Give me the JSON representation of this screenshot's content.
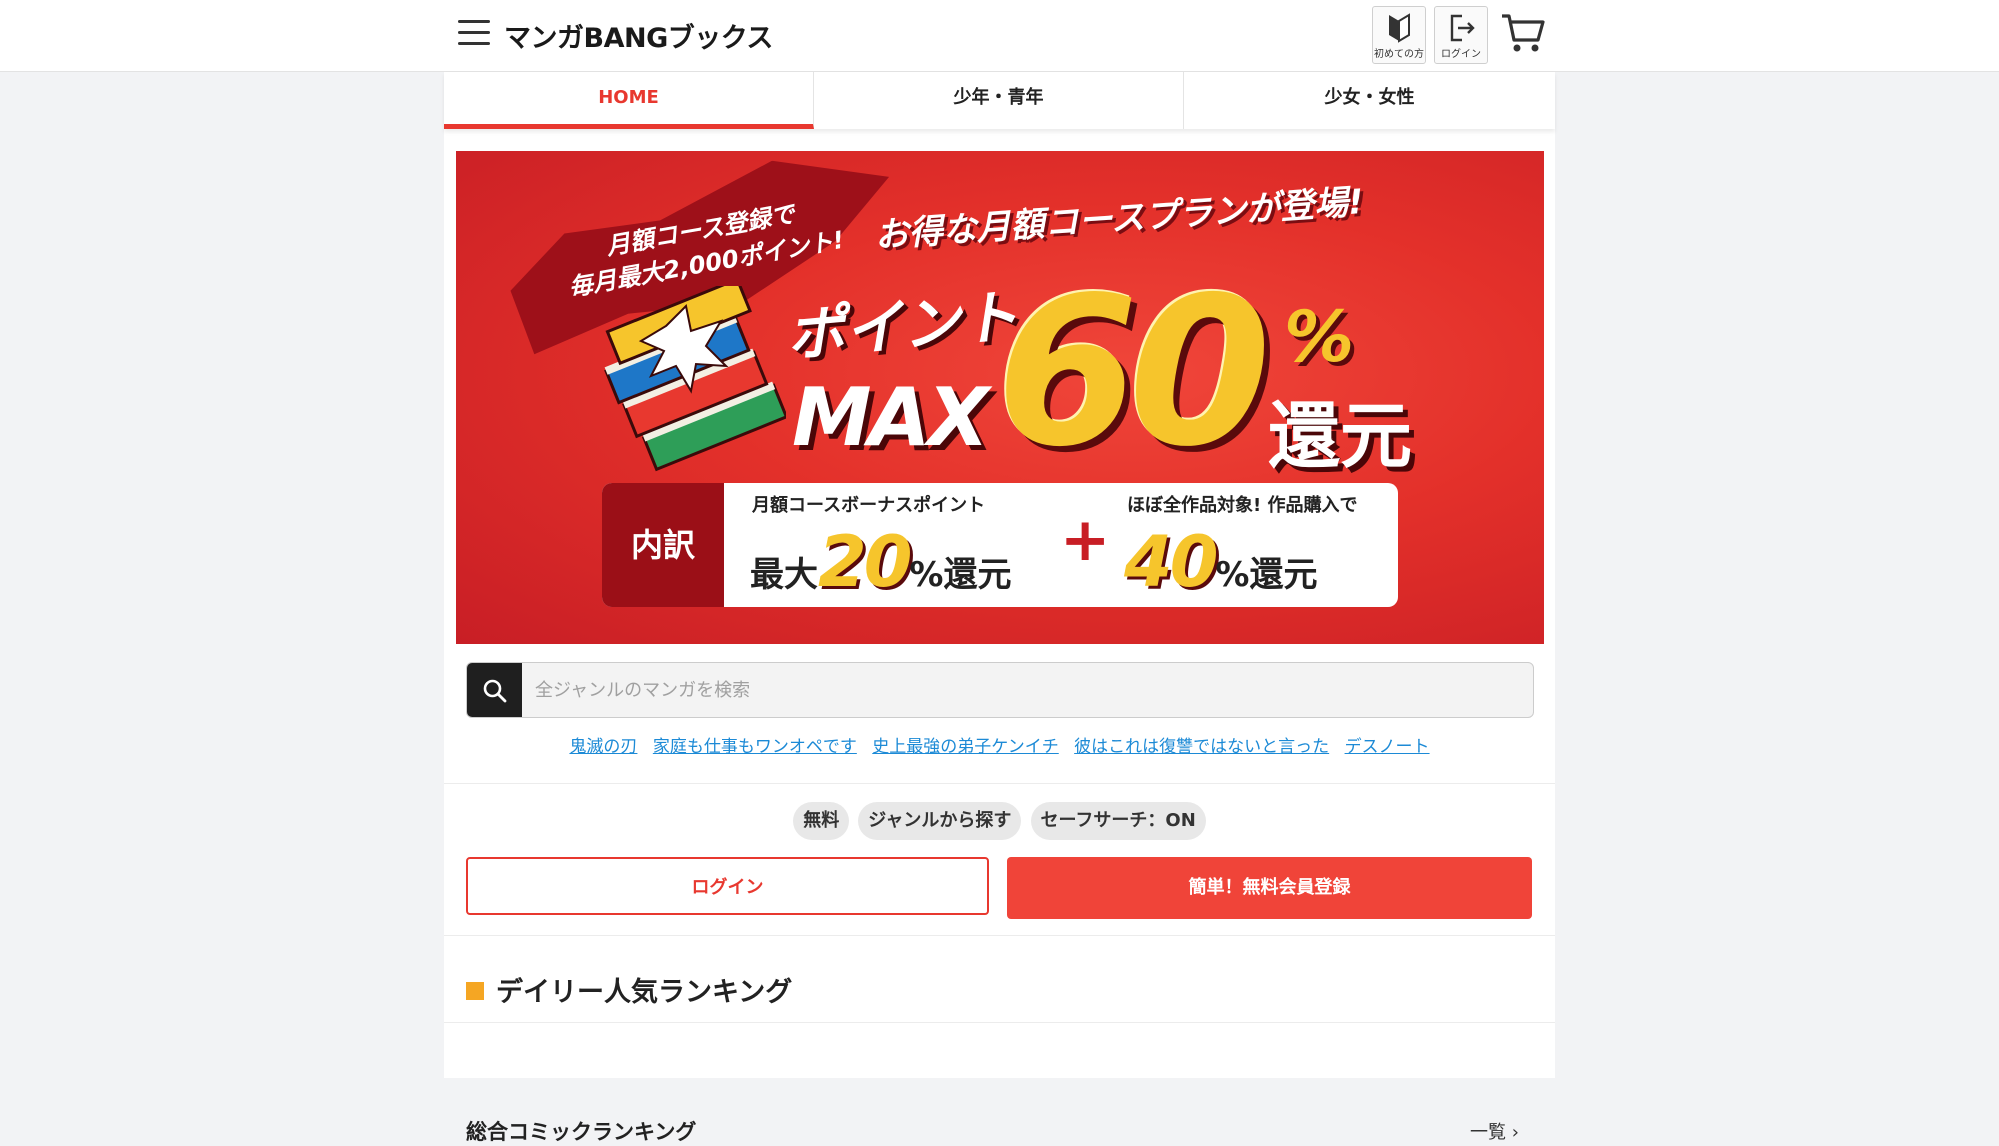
{
  "header": {
    "logo": "マンガBANGブックス",
    "beginner_label": "初めての方",
    "login_icon_label": "ログイン"
  },
  "tabs": [
    {
      "label": "HOME",
      "active": true
    },
    {
      "label": "少年・青年",
      "active": false
    },
    {
      "label": "少女・女性",
      "active": false
    }
  ],
  "banner": {
    "burst_line1": "月額コース登録で",
    "burst_line2": "毎月最大2,000ポイント!",
    "headline": "お得な月額コースプランが登場!",
    "point": "ポイント",
    "max": "MAX",
    "big_number": "60",
    "percent": "%",
    "kangen": "還元",
    "breakdown_tag": "内訳",
    "left_sub": "月額コースボーナスポイント",
    "left_prefix": "最大",
    "left_number": "20",
    "left_suffix": "%還元",
    "plus": "+",
    "right_sub": "ほぼ全作品対象! 作品購入で",
    "right_number": "40",
    "right_suffix": "%還元"
  },
  "search": {
    "placeholder": "全ジャンルのマンガを検索"
  },
  "keywords": [
    "鬼滅の刃",
    "家庭も仕事もワンオペです",
    "史上最強の弟子ケンイチ",
    "彼はこれは復讐ではないと言った",
    "デスノート"
  ],
  "chips": [
    "無料",
    "ジャンルから探す",
    "セーフサーチ：ON"
  ],
  "buttons": {
    "login": "ログイン",
    "register": "簡単！無料会員登録"
  },
  "ranking": {
    "title": "デイリー人気ランキング",
    "subtitle": "総合コミックランキング",
    "more": "一覧 ›"
  },
  "colors": {
    "accent": "#e8382f",
    "link": "#1c8ad6",
    "banner_red": "#e3302a",
    "gold": "#f6c52c",
    "section_marker": "#f5a623"
  }
}
